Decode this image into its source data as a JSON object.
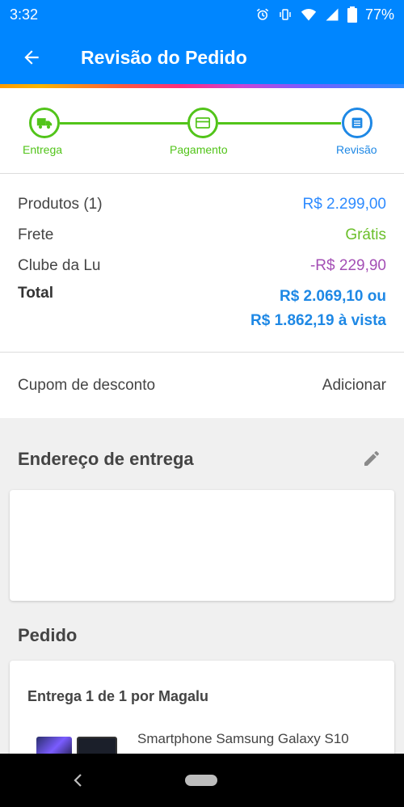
{
  "status": {
    "time": "3:32",
    "battery": "77%"
  },
  "header": {
    "title": "Revisão do Pedido"
  },
  "steps": [
    {
      "label": "Entrega",
      "state": "done"
    },
    {
      "label": "Pagamento",
      "state": "done"
    },
    {
      "label": "Revisão",
      "state": "current"
    }
  ],
  "summary": {
    "products": {
      "label": "Produtos (1)",
      "value": "R$ 2.299,00"
    },
    "shipping": {
      "label": "Frete",
      "value": "Grátis"
    },
    "club": {
      "label": "Clube da Lu",
      "value": "-R$ 229,90"
    },
    "total": {
      "label": "Total",
      "value_line1": "R$ 2.069,10 ou",
      "value_line2": "R$ 1.862,19 à vista"
    }
  },
  "coupon": {
    "label": "Cupom de desconto",
    "action": "Adicionar"
  },
  "address": {
    "title": "Endereço de entrega"
  },
  "order": {
    "title": "Pedido",
    "delivery": "Entrega 1 de 1 por Magalu",
    "product_name": "Smartphone Samsung Galaxy S10"
  },
  "colors": {
    "brand_blue": "#0086ff",
    "step_green": "#52c41a",
    "price_blue": "#2e8bff",
    "club_purple": "#a44fb5"
  }
}
